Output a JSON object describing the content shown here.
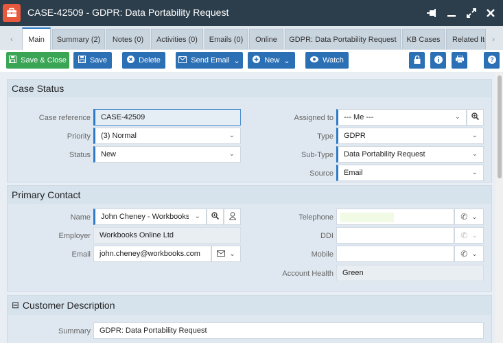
{
  "window": {
    "title": "CASE-42509 - GDPR: Data Portability Request"
  },
  "tabs": [
    {
      "label": "Main"
    },
    {
      "label": "Summary (2)"
    },
    {
      "label": "Notes (0)"
    },
    {
      "label": "Activities (0)"
    },
    {
      "label": "Emails (0)"
    },
    {
      "label": "Online"
    },
    {
      "label": "GDPR: Data Portability Request"
    },
    {
      "label": "KB Cases"
    },
    {
      "label": "Related Ite"
    }
  ],
  "toolbar": {
    "save_close": "Save & Close",
    "save": "Save",
    "delete": "Delete",
    "send_email": "Send Email",
    "new": "New",
    "watch": "Watch"
  },
  "case_status": {
    "title": "Case Status",
    "case_reference_label": "Case reference",
    "case_reference_value": "CASE-42509",
    "priority_label": "Priority",
    "priority_value": "(3) Normal",
    "status_label": "Status",
    "status_value": "New",
    "assigned_label": "Assigned to",
    "assigned_value": "--- Me ---",
    "type_label": "Type",
    "type_value": "GDPR",
    "subtype_label": "Sub-Type",
    "subtype_value": "Data Portability Request",
    "source_label": "Source",
    "source_value": "Email"
  },
  "primary_contact": {
    "title": "Primary Contact",
    "name_label": "Name",
    "name_value": "John Cheney - Workbooks Onl",
    "employer_label": "Employer",
    "employer_value": "Workbooks Online Ltd",
    "email_label": "Email",
    "email_value": "john.cheney@workbooks.com",
    "telephone_label": "Telephone",
    "telephone_value": "",
    "ddi_label": "DDI",
    "ddi_value": "",
    "mobile_label": "Mobile",
    "mobile_value": "",
    "account_health_label": "Account Health",
    "account_health_value": "Green"
  },
  "customer_description": {
    "title": "Customer Description",
    "collapse_symbol": "⊟",
    "summary_label": "Summary",
    "summary_value": "GDPR: Data Portability Request"
  },
  "colors": {
    "titlebar": "#2c3e4c",
    "accent_blue": "#2b6fb5",
    "save_green": "#3aa555",
    "app_icon": "#e8583c"
  }
}
